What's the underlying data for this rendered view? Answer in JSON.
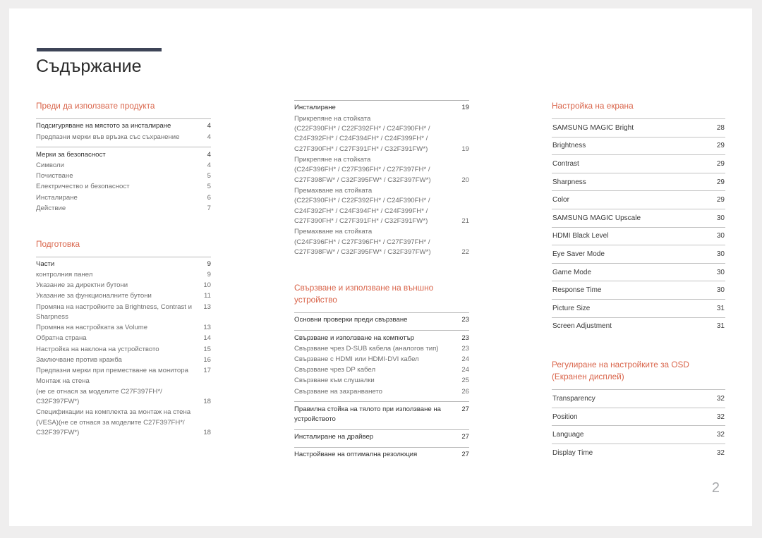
{
  "document": {
    "title": "Съдържание",
    "page_number": "2",
    "accent_color": "#d9644a",
    "rule_color": "#3d4457"
  },
  "columns": {
    "left": {
      "sections": [
        {
          "heading": "Преди да използвате продукта",
          "groups": [
            {
              "entries": [
                {
                  "label": "Подсигуряване на мястото за инсталиране",
                  "page": "4",
                  "lead": true
                },
                {
                  "label": "Предпазни мерки във връзка със съхранение",
                  "page": "4",
                  "lead": false
                }
              ]
            },
            {
              "entries": [
                {
                  "label": "Мерки за безопасност",
                  "page": "4",
                  "lead": true
                },
                {
                  "label": "Символи",
                  "page": "4",
                  "lead": false
                },
                {
                  "label": "Почистване",
                  "page": "5",
                  "lead": false
                },
                {
                  "label": "Електричество и безопасност",
                  "page": "5",
                  "lead": false
                },
                {
                  "label": "Инсталиране",
                  "page": "6",
                  "lead": false
                },
                {
                  "label": "Действие",
                  "page": "7",
                  "lead": false
                }
              ]
            }
          ]
        },
        {
          "heading": "Подготовка",
          "groups": [
            {
              "entries": [
                {
                  "label": "Части",
                  "page": "9",
                  "lead": true
                },
                {
                  "label": "контролния панел",
                  "page": "9",
                  "lead": false
                },
                {
                  "label": "Указание за директни бутони",
                  "page": "10",
                  "lead": false
                },
                {
                  "label": "Указание за функционалните бутони",
                  "page": "11",
                  "lead": false
                },
                {
                  "label": "Промяна на настройките за Brightness, Contrast и Sharpness",
                  "page": "13",
                  "lead": false,
                  "page_on_last_line": true
                },
                {
                  "label": "Промяна на настройката за Volume",
                  "page": "13",
                  "lead": false
                },
                {
                  "label": "Обратна страна",
                  "page": "14",
                  "lead": false
                },
                {
                  "label": "Настройка на наклона на устройството",
                  "page": "15",
                  "lead": false
                },
                {
                  "label": "Заключване против кражба",
                  "page": "16",
                  "lead": false
                },
                {
                  "label": "Предпазни мерки при преместване на монитора",
                  "page": "17",
                  "lead": false
                },
                {
                  "label": "Монтаж на стена\n(не се отнася за моделите C27F397FH*/\nC32F397FW*)",
                  "page": "18",
                  "lead": false,
                  "page_on_last_line": true
                },
                {
                  "label": "Спецификации на комплекта за монтаж на стена (VESA)(не се отнася за моделите C27F397FH*/\nC32F397FW*)",
                  "page": "18",
                  "lead": false,
                  "page_on_last_line": true
                }
              ]
            }
          ]
        }
      ]
    },
    "middle": {
      "sections": [
        {
          "heading": "",
          "groups": [
            {
              "entries": [
                {
                  "label": "Инсталиране",
                  "page": "19",
                  "lead": true
                },
                {
                  "label": "Прикрепяне на стойката\n(C22F390FH* / C22F392FH* / C24F390FH* /\nC24F392FH* / C24F394FH* / C24F399FH* /\nC27F390FH* / C27F391FH* / C32F391FW*)",
                  "page": "19",
                  "lead": false,
                  "page_on_last_line": true
                },
                {
                  "label": "Прикрепяне на стойката\n(C24F396FH* / C27F396FH* / C27F397FH* /\nC27F398FW* / C32F395FW* / C32F397FW*)",
                  "page": "20",
                  "lead": false,
                  "page_on_last_line": true
                },
                {
                  "label": "Премахване на стойката\n(C22F390FH* / C22F392FH* / C24F390FH* /\nC24F392FH* / C24F394FH* / C24F399FH* /\nC27F390FH* / C27F391FH* / C32F391FW*)",
                  "page": "21",
                  "lead": false,
                  "page_on_last_line": true
                },
                {
                  "label": "Премахване на стойката\n(C24F396FH* / C27F396FH* / C27F397FH* /\nC27F398FW* / C32F395FW* / C32F397FW*)",
                  "page": "22",
                  "lead": false,
                  "page_on_last_line": true
                }
              ]
            }
          ]
        },
        {
          "heading": "Свързване и използване на външно устройство",
          "groups": [
            {
              "entries": [
                {
                  "label": "Основни проверки преди свързване",
                  "page": "23",
                  "lead": true
                }
              ]
            },
            {
              "entries": [
                {
                  "label": "Свързване и използване на компютър",
                  "page": "23",
                  "lead": true
                },
                {
                  "label": "Свързване чрез D-SUB кабела (аналогов тип)",
                  "page": "23",
                  "lead": false
                },
                {
                  "label": "Свързване с HDMI или HDMI-DVI кабел",
                  "page": "24",
                  "lead": false
                },
                {
                  "label": "Свързване чрез DP кабел",
                  "page": "24",
                  "lead": false
                },
                {
                  "label": "Свързване към слушалки",
                  "page": "25",
                  "lead": false
                },
                {
                  "label": "Свързване на захранването",
                  "page": "26",
                  "lead": false
                }
              ]
            },
            {
              "entries": [
                {
                  "label": "Правилна стойка на тялото при използване на устройството",
                  "page": "27",
                  "lead": true,
                  "page_on_last_line": true
                }
              ]
            },
            {
              "entries": [
                {
                  "label": "Инсталиране на драйвер",
                  "page": "27",
                  "lead": true
                }
              ]
            },
            {
              "entries": [
                {
                  "label": "Настройване на оптимална резолюция",
                  "page": "27",
                  "lead": true
                }
              ]
            }
          ]
        }
      ]
    },
    "right": {
      "sections": [
        {
          "heading": "Настройка на екрана",
          "rows": [
            {
              "label": "SAMSUNG MAGIC Bright",
              "page": "28"
            },
            {
              "label": "Brightness",
              "page": "29"
            },
            {
              "label": "Contrast",
              "page": "29"
            },
            {
              "label": "Sharpness",
              "page": "29"
            },
            {
              "label": "Color",
              "page": "29"
            },
            {
              "label": "SAMSUNG MAGIC Upscale",
              "page": "30"
            },
            {
              "label": "HDMI Black Level",
              "page": "30"
            },
            {
              "label": "Eye Saver Mode",
              "page": "30"
            },
            {
              "label": "Game Mode",
              "page": "30"
            },
            {
              "label": "Response Time",
              "page": "30"
            },
            {
              "label": "Picture Size",
              "page": "31"
            },
            {
              "label": "Screen Adjustment",
              "page": "31"
            }
          ]
        },
        {
          "heading": "Регулиране на настройките за OSD (Екранен дисплей)",
          "rows": [
            {
              "label": "Transparency",
              "page": "32"
            },
            {
              "label": "Position",
              "page": "32"
            },
            {
              "label": "Language",
              "page": "32"
            },
            {
              "label": "Display Time",
              "page": "32"
            }
          ]
        }
      ]
    }
  }
}
